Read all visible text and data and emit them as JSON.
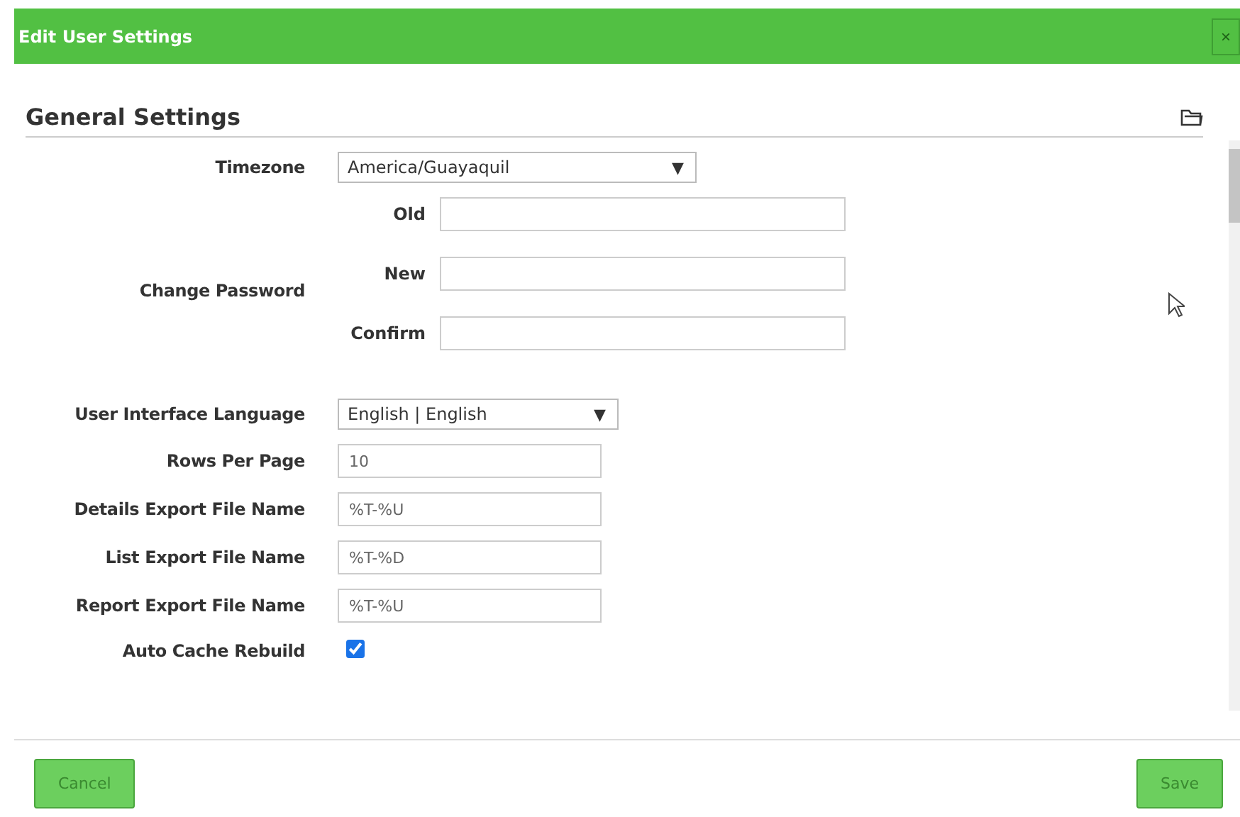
{
  "window": {
    "title": "Edit User Settings",
    "close": "×"
  },
  "section": {
    "title": "General Settings"
  },
  "fields": [
    {
      "kind": "select",
      "label": "Timezone",
      "value": "America/Guayaquil",
      "arrow": "▼"
    },
    {
      "kind": "password",
      "label": "Change Password",
      "inputs": [
        {
          "label": "Old"
        },
        {
          "label": "New"
        },
        {
          "label": "Confirm"
        }
      ]
    },
    {
      "kind": "select",
      "label": "User Interface Language",
      "value": "English | English",
      "arrow": "▼"
    },
    {
      "kind": "text",
      "label": "Rows Per Page",
      "value": "10"
    },
    {
      "kind": "text",
      "label": "Details Export File Name",
      "value": "%T-%U"
    },
    {
      "kind": "text",
      "label": "List Export File Name",
      "value": "%T-%D"
    },
    {
      "kind": "text",
      "label": "Report Export File Name",
      "value": "%T-%U"
    },
    {
      "kind": "checkbox",
      "label": "Auto Cache Rebuild",
      "checked": true
    }
  ],
  "buttons": [
    {
      "label": "Cancel"
    },
    {
      "label": "Save"
    }
  ]
}
